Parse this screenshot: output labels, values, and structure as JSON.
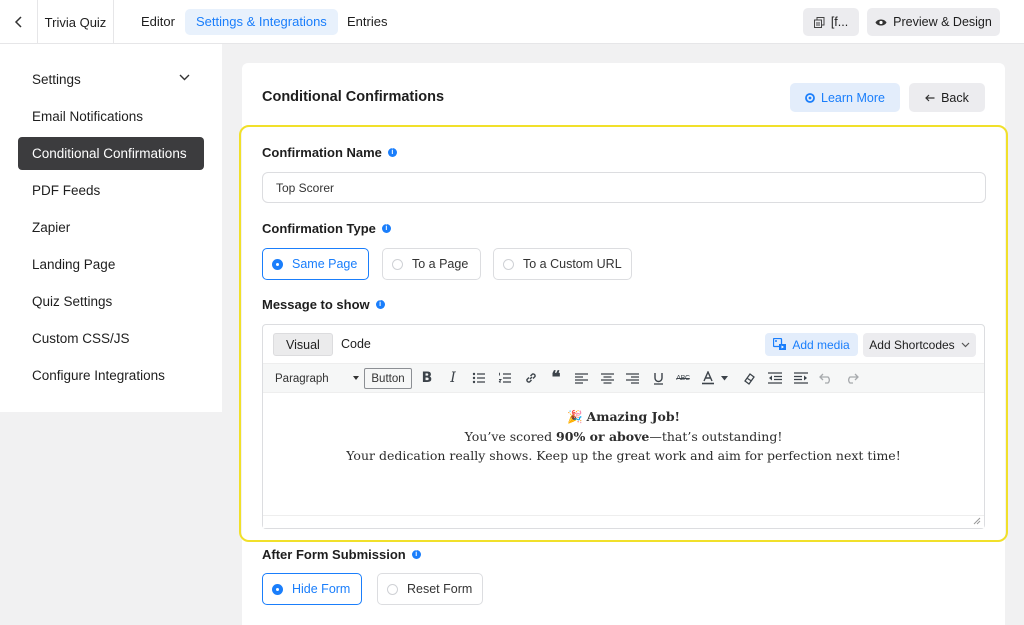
{
  "header": {
    "form_title": "Trivia Quiz",
    "tabs": [
      "Editor",
      "Settings & Integrations",
      "Entries"
    ],
    "shortcode_btn": "[f...",
    "preview_btn": "Preview & Design"
  },
  "sidebar": {
    "items": [
      "Settings",
      "Email Notifications",
      "Conditional Confirmations",
      "PDF Feeds",
      "Zapier",
      "Landing Page",
      "Quiz Settings",
      "Custom CSS/JS",
      "Configure Integrations"
    ]
  },
  "main": {
    "title": "Conditional Confirmations",
    "learn_more": "Learn More",
    "back": "Back",
    "confirmation_name_label": "Confirmation Name",
    "confirmation_name_value": "Top Scorer",
    "confirmation_type_label": "Confirmation Type",
    "type_options": [
      "Same Page",
      "To a Page",
      "To a Custom URL"
    ],
    "message_label": "Message to show",
    "editor": {
      "tab_visual": "Visual",
      "tab_code": "Code",
      "add_media": "Add media",
      "add_shortcodes": "Add Shortcodes",
      "format_select": "Paragraph",
      "button_label": "Button",
      "line1_emoji": "🎉",
      "line1_text": "Amazing Job!",
      "line2_pre": "You’ve scored ",
      "line2_bold": "90% or above",
      "line2_post": "—that’s outstanding!",
      "line3": "Your dedication really shows. Keep up the great work and aim for perfection next time!"
    },
    "after_submit_label": "After Form Submission",
    "after_submit_options": [
      "Hide Form",
      "Reset Form"
    ]
  },
  "colors": {
    "accent": "#1a7efb",
    "highlight_border": "#f1e02a",
    "sidebar_active": "#3c3c3e"
  }
}
